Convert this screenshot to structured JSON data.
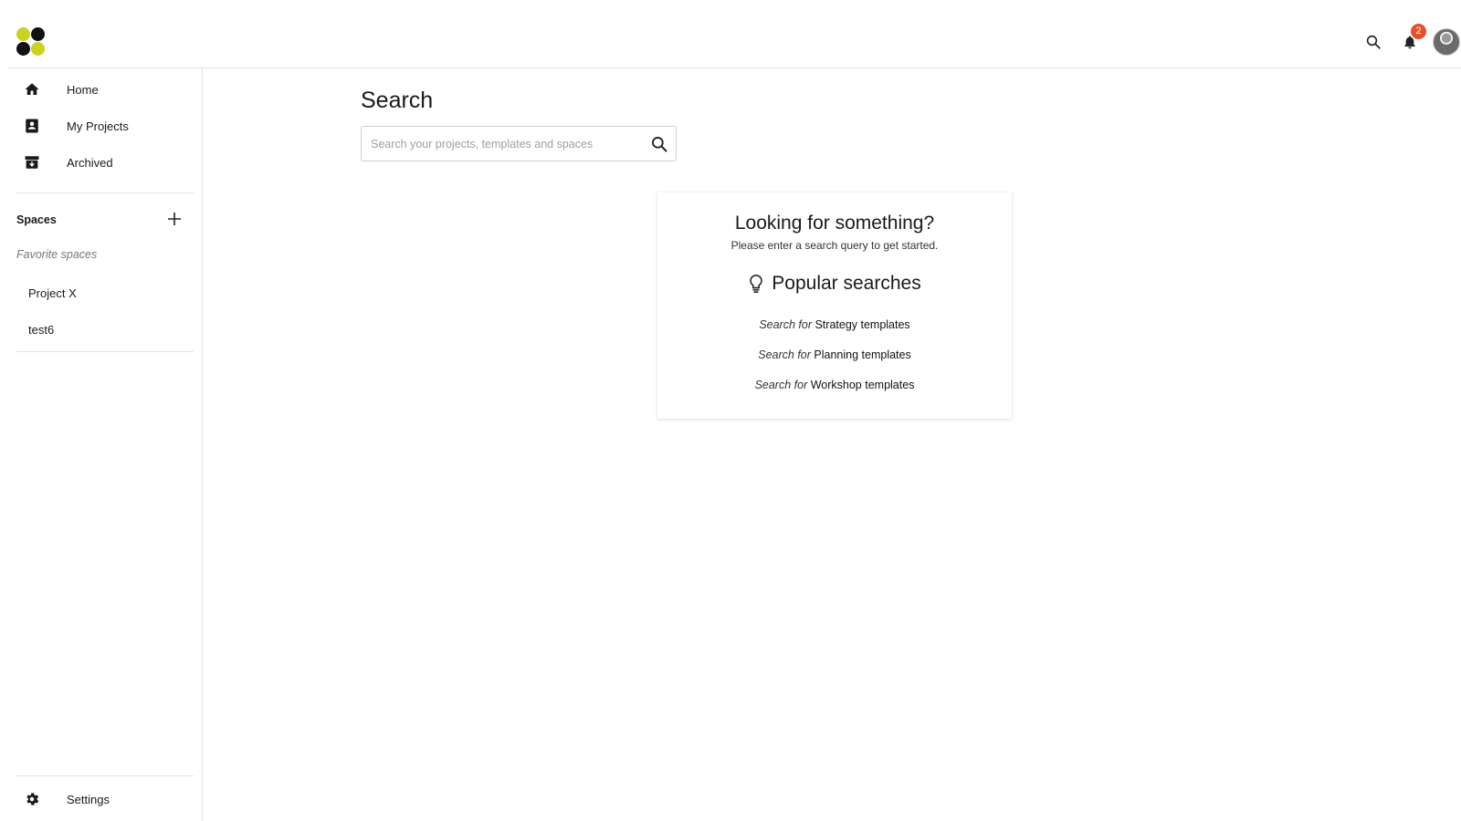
{
  "header": {
    "notification_count": "2",
    "icons": [
      "logo",
      "search-icon",
      "bell-icon",
      "avatar"
    ]
  },
  "sidebar": {
    "nav": [
      {
        "label": "Home",
        "icon": "home-icon"
      },
      {
        "label": "My Projects",
        "icon": "projects-icon"
      },
      {
        "label": "Archived",
        "icon": "archive-icon"
      }
    ],
    "spaces_title": "Spaces",
    "favorite_label": "Favorite spaces",
    "spaces": [
      {
        "label": "Project X"
      },
      {
        "label": "test6"
      }
    ],
    "settings_label": "Settings"
  },
  "main": {
    "title": "Search",
    "search_placeholder": "Search your projects, templates and spaces",
    "search_value": ""
  },
  "card": {
    "title": "Looking for something?",
    "subtitle": "Please enter a search query to get started.",
    "popular_title": "Popular searches",
    "prefix": "Search for",
    "items": [
      {
        "term": "Strategy templates"
      },
      {
        "term": "Planning templates"
      },
      {
        "term": "Workshop templates"
      }
    ]
  },
  "colors": {
    "accent": "#c9d320",
    "badge": "#e8502b",
    "border": "#e3e3e3"
  }
}
